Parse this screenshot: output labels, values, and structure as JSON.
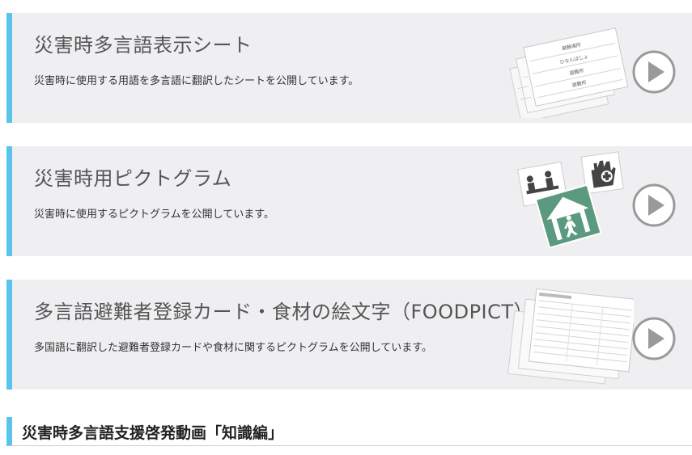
{
  "cards": [
    {
      "title": "災害時多言語表示シート",
      "description": "災害時に使用する用語を多言語に翻訳したシートを公開しています。",
      "thumb_icon": "multilingual-sheet-thumbnail",
      "sheet_lines": [
        "避難場所",
        "ひなんばしょ",
        "避難所",
        "避難所"
      ]
    },
    {
      "title": "災害時用ピクトグラム",
      "description": "災害時に使用するピクトグラムを公開しています。",
      "thumb_icon": "pictogram-thumbnail"
    },
    {
      "title": "多言語避難者登録カード・食材の絵文字（FOODPICT）",
      "description": "多国語に翻訳した避難者登録カードや食材に関するピクトグラムを公開しています。",
      "thumb_icon": "registration-card-thumbnail"
    }
  ],
  "play_icon": "play-circle-icon",
  "section_heading": "災害時多言語支援啓発動画「知識編」",
  "colors": {
    "accent": "#5bc4ec",
    "card_bg": "#efeff2",
    "pictogram_green": "#5b9a7e",
    "play_gray": "#9a9a9a"
  }
}
